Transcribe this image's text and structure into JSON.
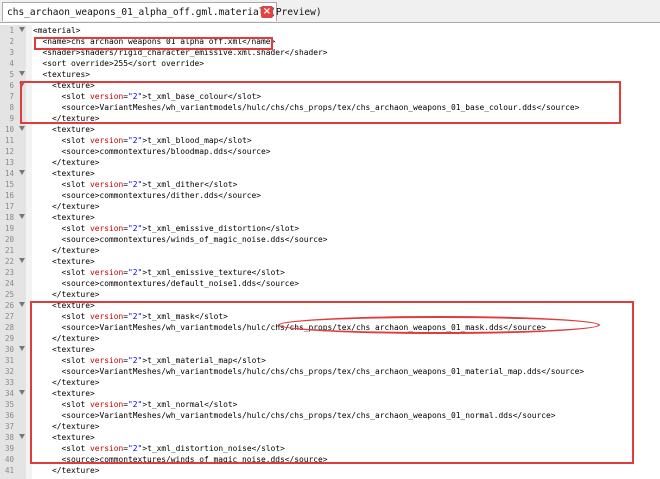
{
  "tab": {
    "title": "chs_archaon_weapons_01_alpha_off.gml.material (Preview)",
    "close_icon": "close-icon"
  },
  "lines": [
    {
      "n": "1",
      "fold": true,
      "parts": [
        [
          "t",
          "<material>"
        ]
      ]
    },
    {
      "n": "2",
      "fold": false,
      "parts": [
        [
          "t",
          "  <name>chs archaon weapons 01 alpha off.xml</name>"
        ]
      ]
    },
    {
      "n": "3",
      "fold": false,
      "parts": [
        [
          "t",
          "  <shader>shaders/rigid_character_emissive.xml.shader</shader>"
        ]
      ]
    },
    {
      "n": "4",
      "fold": false,
      "parts": [
        [
          "t",
          "  <sort override>255</sort override>"
        ]
      ]
    },
    {
      "n": "5",
      "fold": true,
      "parts": [
        [
          "t",
          "  <textures>"
        ]
      ]
    },
    {
      "n": "6",
      "fold": true,
      "parts": [
        [
          "t",
          "    <texture>"
        ]
      ]
    },
    {
      "n": "7",
      "fold": false,
      "parts": [
        [
          "t",
          "      <slot "
        ],
        [
          "a",
          "version"
        ],
        [
          "t",
          "="
        ],
        [
          "v",
          "\"2\""
        ],
        [
          "t",
          ">t_xml_base_colour</slot>"
        ]
      ]
    },
    {
      "n": "8",
      "fold": false,
      "parts": [
        [
          "t",
          "      <source>VariantMeshes/wh_variantmodels/hulc/chs/chs_props/tex/chs_archaon_weapons_01_base_colour.dds</source>"
        ]
      ]
    },
    {
      "n": "9",
      "fold": false,
      "parts": [
        [
          "t",
          "    </texture>"
        ]
      ]
    },
    {
      "n": "10",
      "fold": true,
      "parts": [
        [
          "t",
          "    <texture>"
        ]
      ]
    },
    {
      "n": "11",
      "fold": false,
      "parts": [
        [
          "t",
          "      <slot "
        ],
        [
          "a",
          "version"
        ],
        [
          "t",
          "="
        ],
        [
          "v",
          "\"2\""
        ],
        [
          "t",
          ">t_xml_blood_map</slot>"
        ]
      ]
    },
    {
      "n": "12",
      "fold": false,
      "parts": [
        [
          "t",
          "      <source>commontextures/bloodmap.dds</source>"
        ]
      ]
    },
    {
      "n": "13",
      "fold": false,
      "parts": [
        [
          "t",
          "    </texture>"
        ]
      ]
    },
    {
      "n": "14",
      "fold": true,
      "parts": [
        [
          "t",
          "    <texture>"
        ]
      ]
    },
    {
      "n": "15",
      "fold": false,
      "parts": [
        [
          "t",
          "      <slot "
        ],
        [
          "a",
          "version"
        ],
        [
          "t",
          "="
        ],
        [
          "v",
          "\"2\""
        ],
        [
          "t",
          ">t_xml_dither</slot>"
        ]
      ]
    },
    {
      "n": "16",
      "fold": false,
      "parts": [
        [
          "t",
          "      <source>commontextures/dither.dds</source>"
        ]
      ]
    },
    {
      "n": "17",
      "fold": false,
      "parts": [
        [
          "t",
          "    </texture>"
        ]
      ]
    },
    {
      "n": "18",
      "fold": true,
      "parts": [
        [
          "t",
          "    <texture>"
        ]
      ]
    },
    {
      "n": "19",
      "fold": false,
      "parts": [
        [
          "t",
          "      <slot "
        ],
        [
          "a",
          "version"
        ],
        [
          "t",
          "="
        ],
        [
          "v",
          "\"2\""
        ],
        [
          "t",
          ">t_xml_emissive_distortion</slot>"
        ]
      ]
    },
    {
      "n": "20",
      "fold": false,
      "parts": [
        [
          "t",
          "      <source>commontextures/winds_of_magic_noise.dds</source>"
        ]
      ]
    },
    {
      "n": "21",
      "fold": false,
      "parts": [
        [
          "t",
          "    </texture>"
        ]
      ]
    },
    {
      "n": "22",
      "fold": true,
      "parts": [
        [
          "t",
          "    <texture>"
        ]
      ]
    },
    {
      "n": "23",
      "fold": false,
      "parts": [
        [
          "t",
          "      <slot "
        ],
        [
          "a",
          "version"
        ],
        [
          "t",
          "="
        ],
        [
          "v",
          "\"2\""
        ],
        [
          "t",
          ">t_xml_emissive_texture</slot>"
        ]
      ]
    },
    {
      "n": "24",
      "fold": false,
      "parts": [
        [
          "t",
          "      <source>commontextures/default_noise1.dds</source>"
        ]
      ]
    },
    {
      "n": "25",
      "fold": false,
      "parts": [
        [
          "t",
          "    </texture>"
        ]
      ]
    },
    {
      "n": "26",
      "fold": true,
      "parts": [
        [
          "t",
          "    <texture>"
        ]
      ]
    },
    {
      "n": "27",
      "fold": false,
      "parts": [
        [
          "t",
          "      <slot "
        ],
        [
          "a",
          "version"
        ],
        [
          "t",
          "="
        ],
        [
          "v",
          "\"2\""
        ],
        [
          "t",
          ">t_xml_mask</slot>"
        ]
      ]
    },
    {
      "n": "28",
      "fold": false,
      "parts": [
        [
          "t",
          "      <source>VariantMeshes/wh_variantmodels/hulc/chs/chs_props/tex/chs_archaon_weapons_01_mask.dds</source>"
        ]
      ]
    },
    {
      "n": "29",
      "fold": false,
      "parts": [
        [
          "t",
          "    </texture>"
        ]
      ]
    },
    {
      "n": "30",
      "fold": true,
      "parts": [
        [
          "t",
          "    <texture>"
        ]
      ]
    },
    {
      "n": "31",
      "fold": false,
      "parts": [
        [
          "t",
          "      <slot "
        ],
        [
          "a",
          "version"
        ],
        [
          "t",
          "="
        ],
        [
          "v",
          "\"2\""
        ],
        [
          "t",
          ">t_xml_material_map</slot>"
        ]
      ]
    },
    {
      "n": "32",
      "fold": false,
      "parts": [
        [
          "t",
          "      <source>VariantMeshes/wh_variantmodels/hulc/chs/chs_props/tex/chs_archaon_weapons_01_material_map.dds</source>"
        ]
      ]
    },
    {
      "n": "33",
      "fold": false,
      "parts": [
        [
          "t",
          "    </texture>"
        ]
      ]
    },
    {
      "n": "34",
      "fold": true,
      "parts": [
        [
          "t",
          "    <texture>"
        ]
      ]
    },
    {
      "n": "35",
      "fold": false,
      "parts": [
        [
          "t",
          "      <slot "
        ],
        [
          "a",
          "version"
        ],
        [
          "t",
          "="
        ],
        [
          "v",
          "\"2\""
        ],
        [
          "t",
          ">t_xml_normal</slot>"
        ]
      ]
    },
    {
      "n": "36",
      "fold": false,
      "parts": [
        [
          "t",
          "      <source>VariantMeshes/wh_variantmodels/hulc/chs/chs_props/tex/chs_archaon_weapons_01_normal.dds</source>"
        ]
      ]
    },
    {
      "n": "37",
      "fold": false,
      "parts": [
        [
          "t",
          "    </texture>"
        ]
      ]
    },
    {
      "n": "38",
      "fold": true,
      "parts": [
        [
          "t",
          "    <texture>"
        ]
      ]
    },
    {
      "n": "39",
      "fold": false,
      "parts": [
        [
          "t",
          "      <slot "
        ],
        [
          "a",
          "version"
        ],
        [
          "t",
          "="
        ],
        [
          "v",
          "\"2\""
        ],
        [
          "t",
          ">t_xml_distortion_noise</slot>"
        ]
      ]
    },
    {
      "n": "40",
      "fold": false,
      "parts": [
        [
          "t",
          "      <source>commontextures/winds_of_magic_noise.dds</source>"
        ]
      ]
    },
    {
      "n": "41",
      "fold": false,
      "parts": [
        [
          "t",
          "    </texture>"
        ]
      ]
    }
  ],
  "colors": {
    "highlight": "#e23b3b",
    "attr_name": "#c00000",
    "attr_value": "#0000ff"
  }
}
